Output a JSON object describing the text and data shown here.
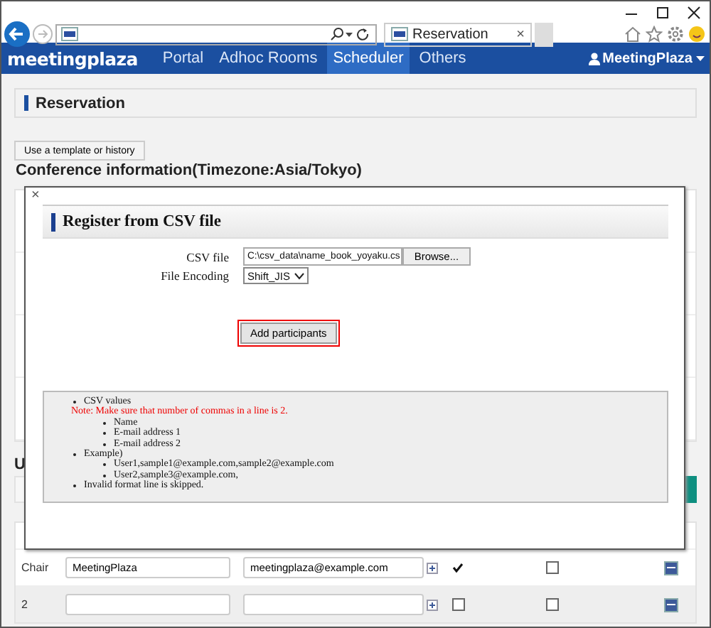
{
  "browser": {
    "tab_title": "Reservation",
    "tab_close": "×"
  },
  "nav": {
    "logo": "meetingplaza",
    "items": [
      {
        "label": "Portal",
        "selected": false
      },
      {
        "label": "Adhoc Rooms",
        "selected": false
      },
      {
        "label": "Scheduler",
        "selected": true
      },
      {
        "label": "Others",
        "selected": false
      }
    ],
    "user": "MeetingPlaza"
  },
  "page": {
    "title": "Reservation",
    "template_button": "Use a template or history",
    "section_heading": "Conference information(Timezone:Asia/Tokyo)",
    "users_heading": "U"
  },
  "dialog": {
    "close": "×",
    "title": "Register from CSV file",
    "fields": [
      {
        "label": "CSV file",
        "kind": "file",
        "value": "C:\\csv_data\\name_book_yoyaku.cs",
        "button": "Browse..."
      },
      {
        "label": "File Encoding",
        "kind": "select",
        "value": "Shift_JIS"
      }
    ],
    "submit": "Add participants",
    "notes": [
      {
        "text": "CSV values",
        "note": "Note: Make sure that number of commas in a line is 2.",
        "children": [
          {
            "text": "Name"
          },
          {
            "text": "E-mail address 1"
          },
          {
            "text": "E-mail address 2"
          }
        ]
      },
      {
        "text": "Example)",
        "children": [
          {
            "text": "User1,sample1@example.com,sample2@example.com"
          },
          {
            "text": "User2,sample3@example.com,"
          }
        ]
      },
      {
        "text": "Invalid format line is skipped."
      }
    ]
  },
  "participants": [
    {
      "label": "Chair",
      "name": "MeetingPlaza",
      "email": "meetingplaza@example.com",
      "chair": {
        "kind": "tick"
      },
      "option_checked": false
    },
    {
      "label": "2",
      "chair": {
        "kind": "checkbox",
        "checked": false
      },
      "option_checked": false
    }
  ]
}
